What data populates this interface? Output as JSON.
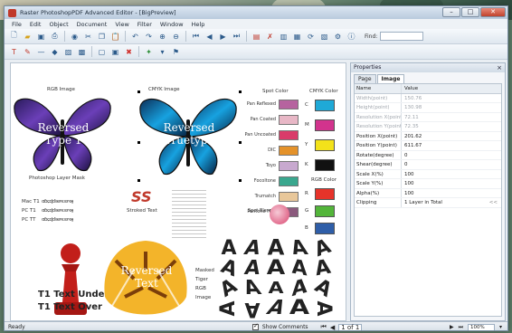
{
  "window": {
    "title": "Raster PhotoshopPDF Advanced Editor - [BigPreview]"
  },
  "menu": [
    "File",
    "Edit",
    "Object",
    "Document",
    "View",
    "Filter",
    "Window",
    "Help"
  ],
  "toolbar": {
    "find_label": "Find:",
    "find_value": ""
  },
  "canvas": {
    "labels": {
      "rgb_image": "RGB Image",
      "cmyk_image": "CMYK Image",
      "spot_color": "Spot Color",
      "cmyk_color": "CMYK Color",
      "rgb_color": "RGB Color",
      "spot_blend": "Spot Blend",
      "photoshop_layer_mask": "Photoshop Layer Mask",
      "stroked_text": "Stroked Text",
      "ss": "SS",
      "mac_t1": "Mac T1",
      "pc_t1": "PC T1",
      "pc_tt": "PC TT",
      "t1_text_under": "T1 Text Under",
      "t1_text_over": "T1 Text Over",
      "masked_tiger": "Masked",
      "tiger_word": "Tiger",
      "rgb_word": "RGB",
      "image_word": "Image",
      "text_line_1": "Reversed",
      "text_line_2": "Type 1",
      "text_line_3": "Reversed",
      "text_line_4": "Truetype",
      "reversed_text_1": "Reversed",
      "reversed_text_2": "Text"
    },
    "spot_names": [
      "Pan Reflexed",
      "Pan Coated",
      "Pan Uncoated",
      "DIC",
      "Toyo",
      "Focoltone",
      "Trumatch",
      "Pantone Hex"
    ],
    "cmyk_letters": [
      "C",
      "M",
      "Y",
      "K"
    ],
    "rgb_letters": [
      "R",
      "G",
      "B"
    ],
    "letter_grid": [
      "A",
      "A",
      "A",
      "A",
      "A",
      "A",
      "A",
      "A",
      "A",
      "A",
      "A",
      "A",
      "A",
      "A",
      "A",
      "A",
      "A",
      "A",
      "A",
      "A"
    ]
  },
  "colors": {
    "spot": [
      "#b6639f",
      "#e8b7c6",
      "#d93c6a",
      "#e4922a",
      "#c8a9cf",
      "#3aa78e",
      "#e8c79a",
      "#8b5a7d"
    ],
    "cmyk": [
      "#1fa9d7",
      "#d2338d",
      "#f3e21a",
      "#111111"
    ],
    "rgb": [
      "#e6332a",
      "#53b53a",
      "#2f5ea8"
    ]
  },
  "properties": {
    "title": "Properties",
    "tabs": [
      "Page",
      "Image"
    ],
    "active_tab": "Image",
    "col_name": "Name",
    "col_value": "Value",
    "rows": [
      {
        "name": "Width(point)",
        "value": "150.76",
        "dim": true
      },
      {
        "name": "Height(point)",
        "value": "130.98",
        "dim": true
      },
      {
        "name": "Resolution X(point)",
        "value": "72.11",
        "dim": true
      },
      {
        "name": "Resolution Y(point)",
        "value": "72.35",
        "dim": true
      },
      {
        "name": "Position X(point)",
        "value": "201.62",
        "dim": false
      },
      {
        "name": "Position Y(point)",
        "value": "611.67",
        "dim": false
      },
      {
        "name": "Rotate(degree)",
        "value": "0",
        "dim": false
      },
      {
        "name": "Shear(degree)",
        "value": "0",
        "dim": false
      },
      {
        "name": "Scale X(%)",
        "value": "100",
        "dim": false
      },
      {
        "name": "Scale Y(%)",
        "value": "100",
        "dim": false
      },
      {
        "name": "Alpha(%)",
        "value": "100",
        "dim": false
      },
      {
        "name": "Clipping",
        "value": "1 Layer in Total",
        "dim": false
      }
    ],
    "more": "<<"
  },
  "status": {
    "ready": "Ready",
    "show_comments": "Show Comments",
    "page": "1 of 1",
    "zoom": "100%"
  }
}
